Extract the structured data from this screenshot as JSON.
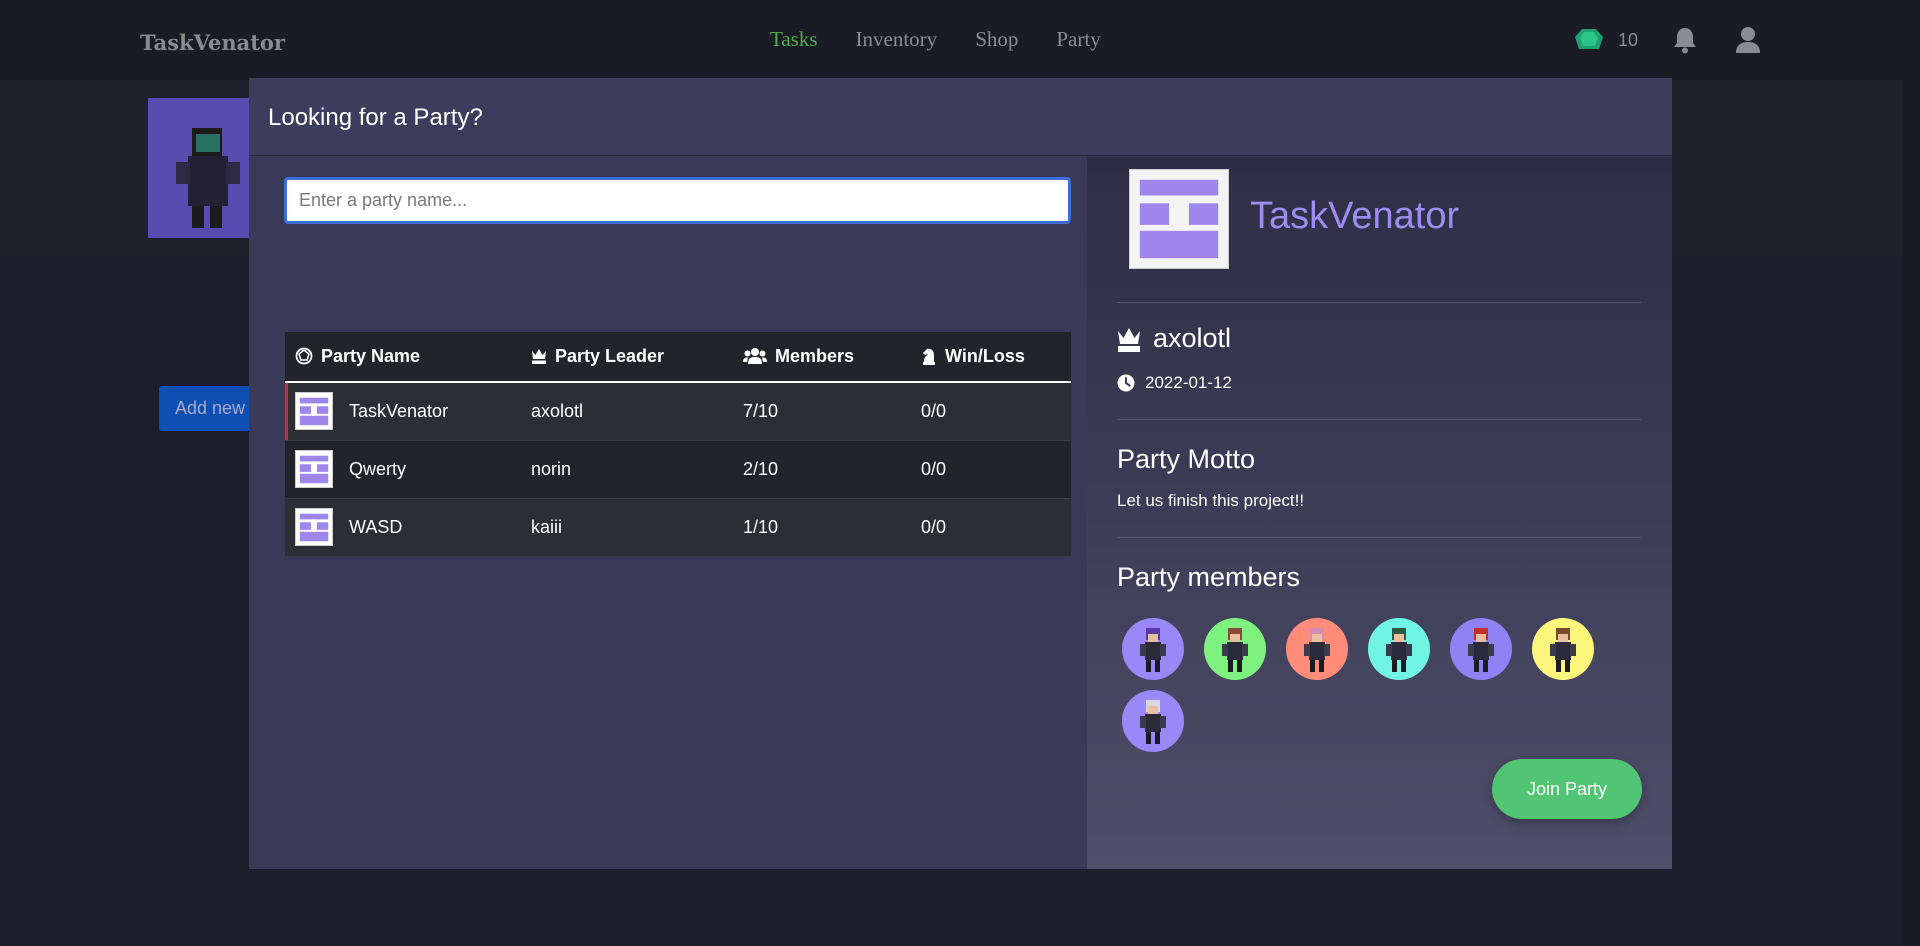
{
  "nav": {
    "brand": "TaskVenator",
    "links": [
      "Tasks",
      "Inventory",
      "Shop",
      "Party"
    ],
    "active_link": "Tasks",
    "gem_count": "10"
  },
  "background": {
    "add_button_label": "Add new"
  },
  "modal": {
    "title": "Looking for a Party?",
    "search": {
      "placeholder": "Enter a party name...",
      "value": ""
    },
    "table": {
      "headers": [
        "Party Name",
        "Party Leader",
        "Members",
        "Win/Loss"
      ],
      "rows": [
        {
          "name": "TaskVenator",
          "leader": "axolotl",
          "members": "7/10",
          "winloss": "0/0"
        },
        {
          "name": "Qwerty",
          "leader": "norin",
          "members": "2/10",
          "winloss": "0/0"
        },
        {
          "name": "WASD",
          "leader": "kaiii",
          "members": "1/10",
          "winloss": "0/0"
        }
      ]
    },
    "detail": {
      "party_name": "TaskVenator",
      "leader": "axolotl",
      "created": "2022-01-12",
      "motto_heading": "Party Motto",
      "motto": "Let us finish this project!!",
      "members_heading": "Party members",
      "member_colors": [
        "#9a88f7",
        "#7ff17f",
        "#ff8c78",
        "#72f4e4",
        "#8f82f5",
        "#fcf77c",
        "#9a88f7"
      ],
      "join_label": "Join Party"
    }
  },
  "colors": {
    "accent_purple": "#9f8cf0",
    "active_nav": "#4caf50",
    "join_green": "#52c575",
    "selected_row_marker": "#e0242a"
  }
}
